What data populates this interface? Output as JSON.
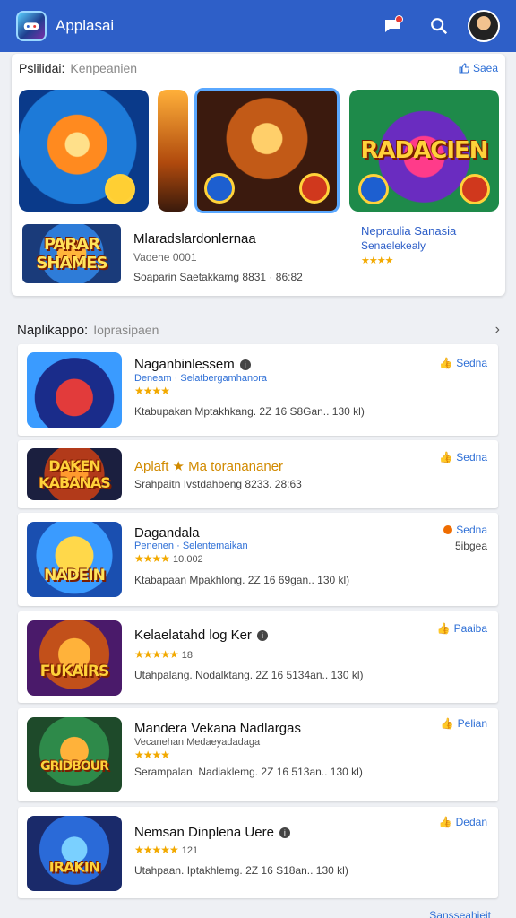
{
  "header": {
    "title": "Applasai",
    "logo_icon": "game-controller-icon",
    "icons": [
      "chat-icon",
      "search-icon",
      "avatar"
    ]
  },
  "featured": {
    "title": "Pslilidai:",
    "subtitle": "Kenpeanien",
    "right_label": "Saea",
    "banners": [
      {
        "word": ""
      },
      {
        "word": ""
      },
      {
        "word": ""
      },
      {
        "word": "RADACIEN"
      }
    ],
    "item": {
      "thumb_word": "PARAR SHAMES",
      "title": "Mlaradslardonlernaa",
      "meta1": "Vaoene 0001",
      "meta2": "Soaparin Saetakkamg 8831 · 86:82"
    },
    "side": {
      "title": "Nepraulia Sanasia",
      "subtitle": "Senaelekealy",
      "stars": "★★★★"
    }
  },
  "list": {
    "title": "Naplikappo:",
    "subtitle": "Ioprasipaen",
    "apps": [
      {
        "name": "Naganbinlessem",
        "sub": "Deneam · Selatbergamhanora",
        "stars": "★★★★",
        "meta": "Ktabupakan Mptakhkang. 2Z 16 S8Gan.. 130 kl)",
        "action": "Sedna",
        "word": "",
        "style": "car"
      },
      {
        "name": "Aplaft ★ Ma toranananer",
        "meta": "Srahpaitn Ivstdahbeng 8233. 28:63",
        "action": "Sedna",
        "word": "DAKEN KABANAS",
        "style": "kab"
      },
      {
        "name": "Dagandala",
        "sub": "Penenen · Selentemaikan",
        "stars": "★★★★",
        "starsN": "10.002",
        "meta": "Ktabapaan Mpakhlong. 2Z 16 69gan.. 130 kl)",
        "action": "Sedna",
        "extra": "5ibgea",
        "word": "NADEIN",
        "style": "pika"
      },
      {
        "name": "Kelaelatahd log Ker",
        "stars": "★★★★★",
        "starsN": "18",
        "meta": "Utahpalang. Nodalktang. 2Z 16 5134an.. 130 kl)",
        "action": "Paaiba",
        "word": "FUKAIRS",
        "style": "fuk"
      },
      {
        "name": "Mandera Vekana Nadlargas",
        "sub": "Vecanehan Medaeyadadaga",
        "stars": "★★★★",
        "meta": "Serampalan. Nadiaklemg. 2Z 16 513an.. 130 kl)",
        "action": "Pelian",
        "word": "GRIDBOUR",
        "style": "grid"
      },
      {
        "name": "Nemsan Dinplena Uere",
        "stars": "★★★★★",
        "starsN": "121",
        "meta": "Utahpaan. Iptakhlemg. 2Z 16 S18an.. 130 kl)",
        "action": "Dedan",
        "word": "IRAKIN",
        "style": "irak"
      }
    ]
  },
  "footer": {
    "link": "Sansseahieit"
  }
}
